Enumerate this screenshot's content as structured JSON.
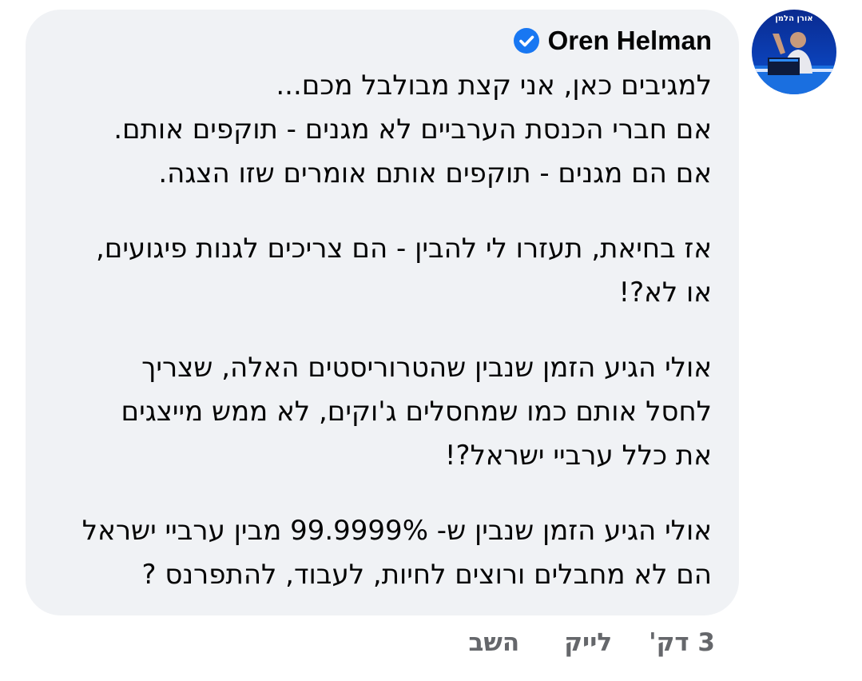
{
  "comment": {
    "author": "Oren Helman",
    "avatar_text": "אורן הלמן",
    "verified_icon": "verified-badge-icon",
    "verified_color": "#1877f2",
    "lines_para1": [
      "למגיבים כאן, אני קצת מבולבל מכם...",
      "אם חברי הכנסת הערביים לא מגנים - תוקפים אותם.",
      "אם הם מגנים - תוקפים אותם אומרים שזו הצגה."
    ],
    "lines_para2": [
      "אז בחיאת, תעזרו לי להבין - הם צריכים לגנות פיגועים,",
      "או לא?!"
    ],
    "lines_para3": [
      "אולי הגיע הזמן שנבין שהטרוריסטים האלה, שצריך",
      "לחסל אותם כמו שמחסלים ג'וקים, לא ממש מייצגים",
      "את כלל ערביי ישראל?!"
    ],
    "lines_para4": [
      "אולי הגיע הזמן שנבין ש- 99.9999% מבין ערביי ישראל",
      "הם לא מחבלים ורוצים לחיות, לעבוד, להתפרנס ?"
    ]
  },
  "actions": {
    "time": "3 דק'",
    "like": "לייק",
    "reply": "השב"
  },
  "colors": {
    "bubble": "#f0f2f5",
    "text": "#050505",
    "secondary": "#65676b"
  }
}
